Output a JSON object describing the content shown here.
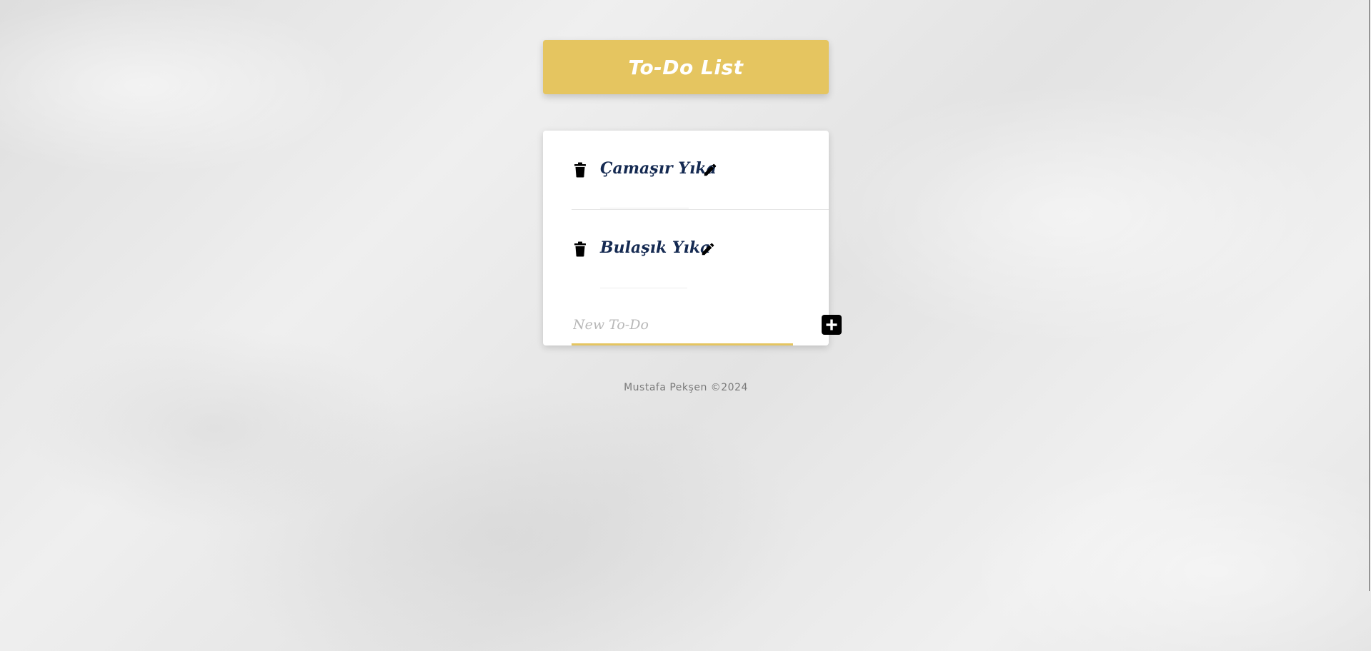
{
  "app": {
    "title": "To-Do List"
  },
  "todos": [
    {
      "label": "Çamaşır Yıka",
      "delete_icon": "trash-icon",
      "edit_icon": "pencil-icon"
    },
    {
      "label": "Bulaşık Yıka",
      "delete_icon": "trash-icon",
      "edit_icon": "pencil-icon"
    }
  ],
  "new_todo": {
    "placeholder": "New To-Do",
    "value": "",
    "add_icon": "plus-square-icon"
  },
  "footer": {
    "text": "Mustafa Pekşen ©2024"
  },
  "colors": {
    "accent": "#e5c560",
    "task_text": "#152a52",
    "background": "#e9e9e9"
  }
}
